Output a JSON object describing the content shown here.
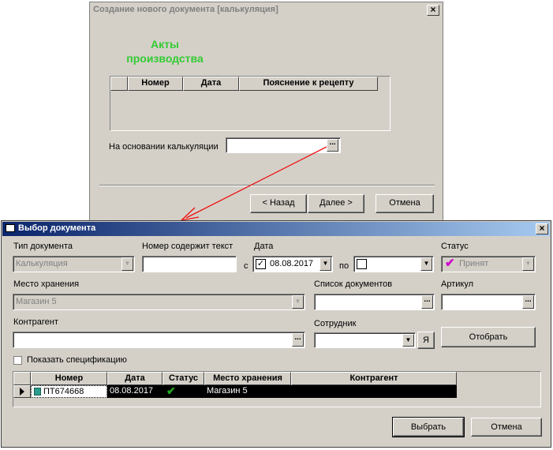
{
  "wizard": {
    "title": "Создание нового документа [калькуляция]",
    "heading_line1": "Акты",
    "heading_line2": "производства",
    "grid_columns": [
      "",
      "Номер",
      "Дата",
      "Пояснение к рецепту"
    ],
    "basis_label": "На основании калькуляции",
    "basis_value": "",
    "back_button": "< Назад",
    "next_button": "Далее >",
    "cancel_button": "Отмена",
    "heading_color": "#33cc33"
  },
  "dialog": {
    "title": "Выбор документа",
    "doc_type_label": "Тип документа",
    "doc_type_value": "Калькуляция",
    "number_contains_label": "Номер содержит текст",
    "number_contains_value": "",
    "date_label": "Дата",
    "date_from_prefix": "с",
    "date_from_value": "08.08.2017",
    "date_from_checked": true,
    "date_to_prefix": "по",
    "date_to_value": "",
    "status_label": "Статус",
    "status_value": "Принят",
    "storage_label": "Место хранения",
    "storage_value": "Магазин 5",
    "doc_list_label": "Список документов",
    "doc_list_value": "",
    "article_label": "Артикул",
    "article_value": "",
    "counterparty_label": "Контрагент",
    "counterparty_value": "",
    "employee_label": "Сотрудник",
    "employee_value": "",
    "employee_me_button": "Я",
    "filter_button": "Отобрать",
    "show_spec_label": "Показать спецификацию",
    "show_spec_checked": false,
    "grid_columns": [
      "Номер",
      "Дата",
      "Статус",
      "Место хранения",
      "Контрагент"
    ],
    "rows": [
      {
        "number": "ПТ674668",
        "date": "08.08.2017",
        "status": "check",
        "storage": "Магазин 5",
        "counterparty": ""
      }
    ],
    "select_button": "Выбрать",
    "cancel_button": "Отмена",
    "title_gradient_start": "#0a246a",
    "title_gradient_end": "#a6caf0",
    "status_check_color": "#cc00cc",
    "row_check_color": "#22aa22"
  },
  "arrow_color": "#ee1111"
}
